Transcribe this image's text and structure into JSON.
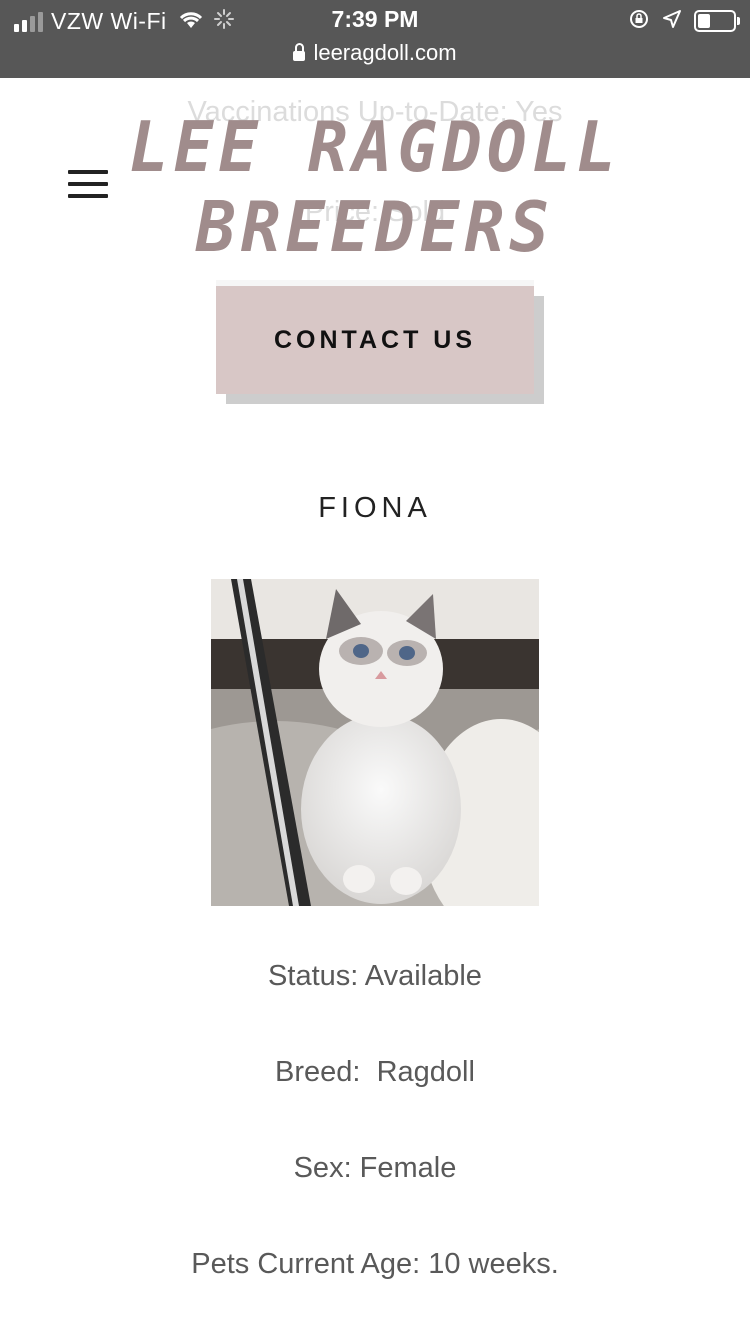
{
  "status_bar": {
    "carrier": "VZW Wi-Fi",
    "time": "7:39 PM",
    "url": "leeragdoll.com",
    "icons": [
      "signal-icon",
      "wifi-icon",
      "loading-spinner-icon",
      "rotation-lock-icon",
      "location-arrow-icon",
      "battery-icon"
    ]
  },
  "background_text": {
    "line1": "Vaccinations Up-to-Date: Yes",
    "line2": "Price: Sold"
  },
  "header": {
    "logo_line1": "LEE RAGDOLL",
    "logo_line2": "BREEDERS",
    "menu_icon": "hamburger-menu-icon",
    "contact_label": "CONTACT US"
  },
  "pet": {
    "name": "FIONA",
    "status": "Status: Available",
    "breed": "Breed:  Ragdoll",
    "sex": "Sex: Female",
    "age": "Pets Current Age: 10 weeks."
  },
  "colors": {
    "status_bar": "#575757",
    "logo": "#a08c8c",
    "button": "#d8c7c6",
    "body_text": "#595959"
  }
}
